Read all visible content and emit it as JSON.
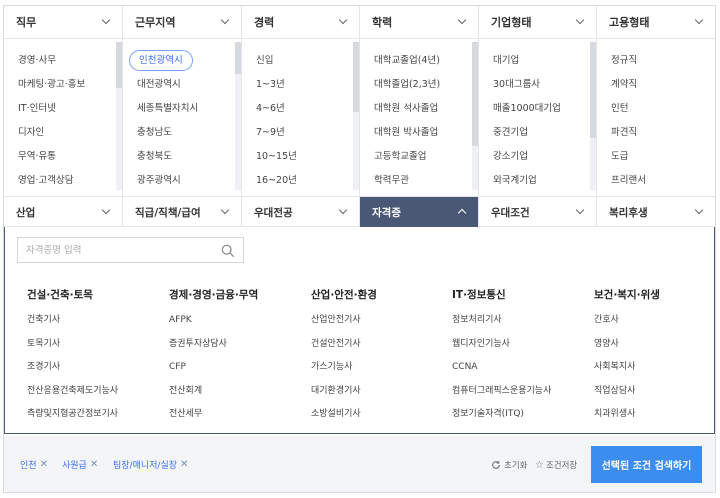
{
  "columns": [
    {
      "label": "직무",
      "items": [
        "경영·사무",
        "마케팅·광고·홍보",
        "IT·인터넷",
        "디자인",
        "무역·유통",
        "영업·고객상담"
      ]
    },
    {
      "label": "근무지역",
      "items": [
        "인천광역시",
        "대전광역시",
        "세종특별자치시",
        "충청남도",
        "충청북도",
        "광주광역시"
      ]
    },
    {
      "label": "경력",
      "items": [
        "신입",
        "1~3년",
        "4~6년",
        "7~9년",
        "10~15년",
        "16~20년"
      ]
    },
    {
      "label": "학력",
      "items": [
        "대학교졸업(4년)",
        "대학졸업(2,3년)",
        "대학원 석사졸업",
        "대학원 박사졸업",
        "고등학교졸업",
        "학력무관"
      ]
    },
    {
      "label": "기업형태",
      "items": [
        "대기업",
        "30대그룹사",
        "매출1000대기업",
        "중견기업",
        "강소기업",
        "외국계기업"
      ]
    },
    {
      "label": "고용형태",
      "items": [
        "정규직",
        "계약직",
        "인턴",
        "파견직",
        "도급",
        "프리랜서"
      ]
    }
  ],
  "tabs2": [
    {
      "label": "산업"
    },
    {
      "label": "직급/직책/급여"
    },
    {
      "label": "우대전공"
    },
    {
      "label": "자격증"
    },
    {
      "label": "우대조건"
    },
    {
      "label": "복리후생"
    }
  ],
  "cert": {
    "search_placeholder": "자격증명 입력",
    "groups": [
      {
        "title": "건설·건축·토목",
        "items": [
          "건축기사",
          "토목기사",
          "조경기사",
          "전산응용건축제도기능사",
          "측량및지형공간정보기사"
        ]
      },
      {
        "title": "경제·경영·금융·무역",
        "items": [
          "AFPK",
          "증권투자상담사",
          "CFP",
          "전산회계",
          "전산세무"
        ]
      },
      {
        "title": "산업·안전·환경",
        "items": [
          "산업안전기사",
          "건설안전기사",
          "가스기능사",
          "대기환경기사",
          "소방설비기사"
        ]
      },
      {
        "title": "IT·정보통신",
        "items": [
          "정보처리기사",
          "웹디자인기능사",
          "CCNA",
          "컴퓨터그래픽스운용기능사",
          "정보기술자격(ITQ)"
        ]
      },
      {
        "title": "보건·복지·위생",
        "items": [
          "간호사",
          "영양사",
          "사회복지사",
          "직업상담사",
          "치과위생사"
        ]
      }
    ]
  },
  "selected_chips": [
    "인천",
    "사원급",
    "팀장/매니저/실장"
  ],
  "reset_label": "초기화",
  "save_label": "조건저장",
  "search_button_label": "선택된 조건 검색하기",
  "colors": {
    "accent": "#3b8ef0",
    "active_tab": "#4a5775",
    "chip": "#3b6ef5"
  }
}
